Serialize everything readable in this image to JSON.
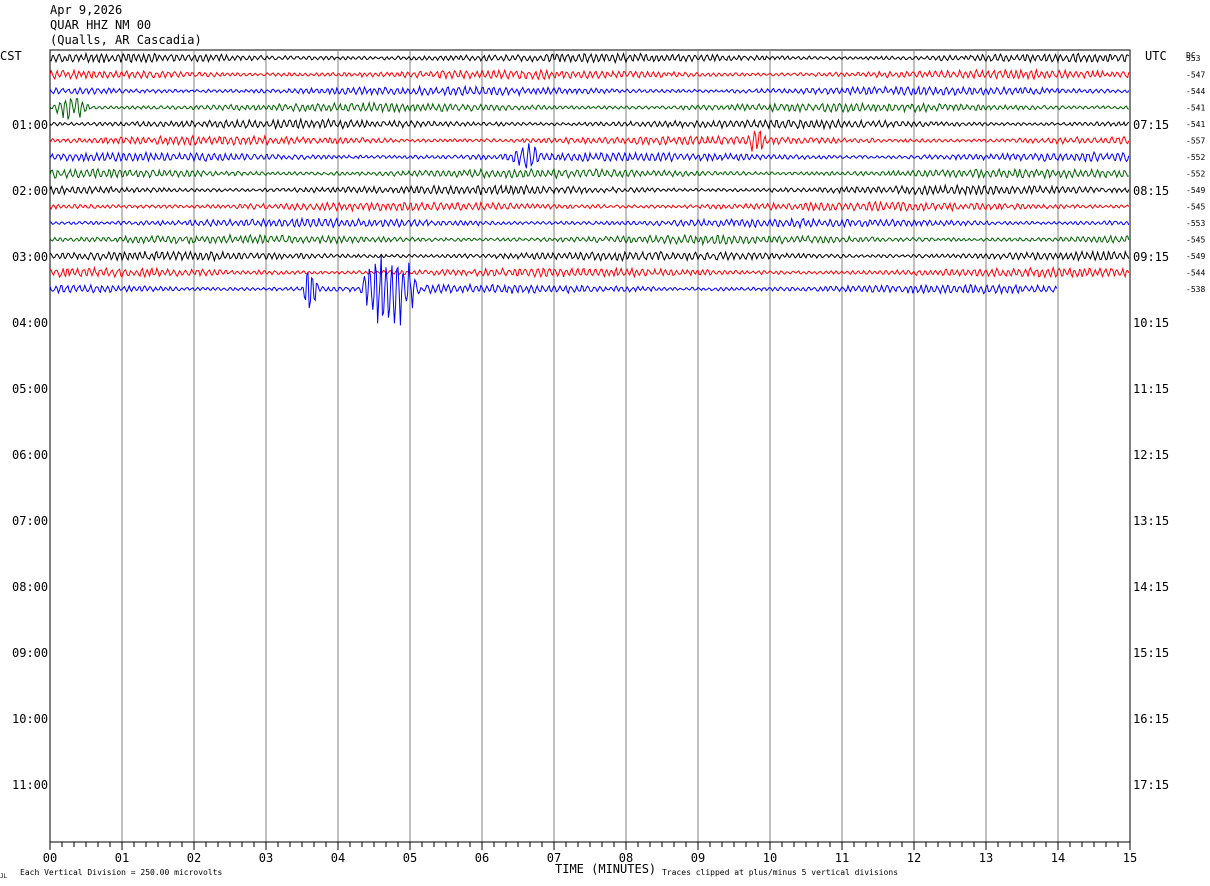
{
  "header": {
    "date": "Apr 9,2026",
    "station": "QUAR HHZ NM 00",
    "location": "(Qualls, AR Cascadia)"
  },
  "labels": {
    "left_tz": "CST",
    "right_tz": "UTC",
    "dc": "DC",
    "xlabel": "TIME (MINUTES)",
    "footer_left": "Each Vertical Division =  250.00 microvolts",
    "footer_right": "Traces clipped at plus/minus 5 vertical divisions",
    "corner_mark": "JL"
  },
  "colors": {
    "cycle": [
      "#000000",
      "#ff0000",
      "#0000ff",
      "#006400"
    ],
    "grid": "#808080"
  },
  "chart_data": {
    "type": "line",
    "title": "QUAR HHZ NM 00",
    "xlabel": "TIME (MINUTES)",
    "x_ticks": [
      "00",
      "01",
      "02",
      "03",
      "04",
      "05",
      "06",
      "07",
      "08",
      "09",
      "10",
      "11",
      "12",
      "13",
      "14",
      "15"
    ],
    "xlim": [
      0,
      15
    ],
    "left_hour_labels": [
      "01:00",
      "02:00",
      "03:00",
      "04:00",
      "05:00",
      "06:00",
      "07:00",
      "08:00",
      "09:00",
      "10:00",
      "11:00"
    ],
    "right_hour_labels": [
      "07:15",
      "08:15",
      "09:15",
      "10:15",
      "11:15",
      "12:15",
      "13:15",
      "14:15",
      "15:15",
      "16:15",
      "17:15"
    ],
    "dc_offsets": [
      "553",
      "-547",
      "-544",
      "-541",
      "-541",
      "-557",
      "-552",
      "-552",
      "-549",
      "-545",
      "-553",
      "-545",
      "-549",
      "-544",
      "-538"
    ],
    "trace_count": 15,
    "last_trace_end_minute": 14.0,
    "events": [
      {
        "trace": 3,
        "start_min": 0.05,
        "end_min": 0.7,
        "amp": 1.6
      },
      {
        "trace": 5,
        "start_min": 9.7,
        "end_min": 10.0,
        "amp": 1.5
      },
      {
        "trace": 6,
        "start_min": 6.4,
        "end_min": 7.0,
        "amp": 1.4
      },
      {
        "trace": 14,
        "start_min": 3.5,
        "end_min": 3.8,
        "amp": 2.8
      },
      {
        "trace": 14,
        "start_min": 4.3,
        "end_min": 5.4,
        "amp": 5.2
      }
    ]
  }
}
